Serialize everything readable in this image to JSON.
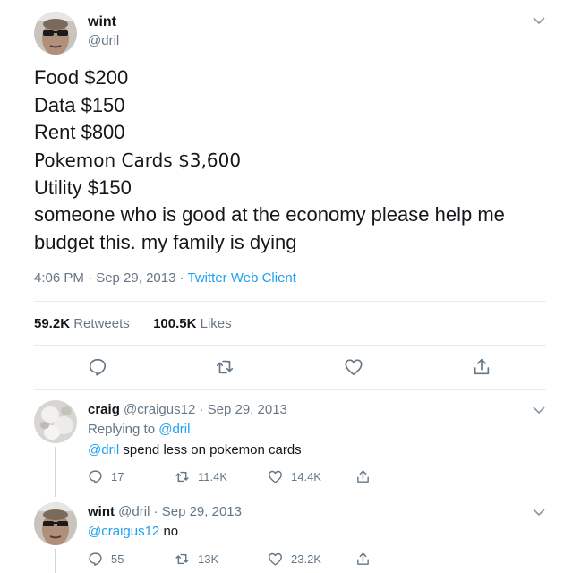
{
  "main_tweet": {
    "name": "wint",
    "handle": "@dril",
    "lines": [
      "Food $200",
      "Data $150",
      "Rent $800",
      "Pokemon Cards $3,600",
      "Utility $150",
      "someone who is good at the economy please help me",
      "budget this. my family is dying"
    ],
    "timestamp": "4:06 PM · Sep 29, 2013 · ",
    "client": "Twitter Web Client",
    "retweets_count": "59.2K",
    "retweets_label": "Retweets",
    "likes_count": "100.5K",
    "likes_label": "Likes"
  },
  "replies": [
    {
      "name": "craig",
      "handle_date": "@craigus12 · Sep 29, 2013",
      "replying_prefix": "Replying to ",
      "replying_to": "@dril",
      "mention": "@dril",
      "text": " spend less on pokemon cards",
      "replies_count": "17",
      "retweets_count": "11.4K",
      "likes_count": "14.4K"
    },
    {
      "name": "wint",
      "handle_date": "@dril · Sep 29, 2013",
      "mention": "@craigus12",
      "text": " no",
      "replies_count": "55",
      "retweets_count": "13K",
      "likes_count": "23.2K"
    }
  ],
  "icons": [
    "reply-icon",
    "retweet-icon",
    "like-icon",
    "share-icon",
    "chevron-down-icon",
    "avatar"
  ],
  "colors": {
    "link": "#1da1f2",
    "muted": "#657786",
    "text": "#14171a",
    "divider": "#e6ecf0"
  }
}
